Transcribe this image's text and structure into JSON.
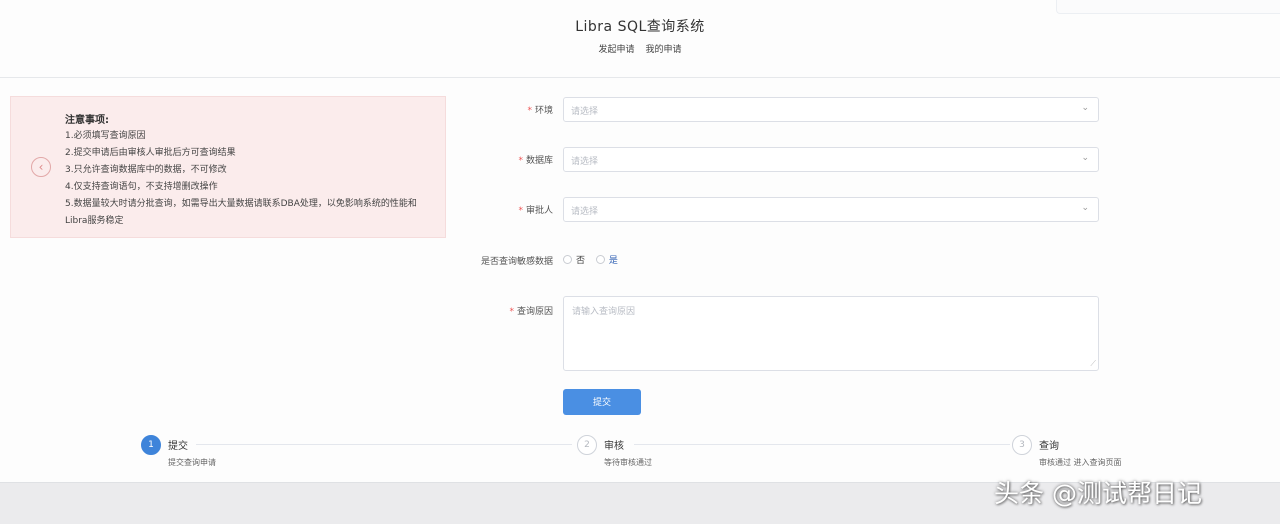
{
  "header": {
    "title": "Libra SQL查询系统",
    "subtitle_left": "发起申请",
    "subtitle_right": "我的申请"
  },
  "notice": {
    "title": "注意事项:",
    "lines": [
      "1.必须填写查询原因",
      "2.提交申请后由审核人审批后方可查询结果",
      "3.只允许查询数据库中的数据，不可修改",
      "4.仅支持查询语句，不支持增删改操作",
      "5.数据量较大时请分批查询，如需导出大量数据请联系DBA处理，以免影响系统的性能和",
      "Libra服务稳定"
    ]
  },
  "form": {
    "env_label": "环境",
    "env_placeholder": "请选择",
    "db_label": "数据库",
    "db_placeholder": "请选择",
    "approver_label": "审批人",
    "approver_placeholder": "请选择",
    "sensitive_label": "是否查询敏感数据",
    "radio_no": "否",
    "radio_yes": "是",
    "reason_label": "查询原因",
    "reason_placeholder": "请输入查询原因",
    "submit_label": "提交"
  },
  "steps": [
    {
      "num": "1",
      "title": "提交",
      "desc": "提交查询申请"
    },
    {
      "num": "2",
      "title": "审核",
      "desc": "等待审核通过"
    },
    {
      "num": "3",
      "title": "查询",
      "desc": "审核通过 进入查询页面"
    }
  ],
  "watermark": "头条 @测试帮日记"
}
